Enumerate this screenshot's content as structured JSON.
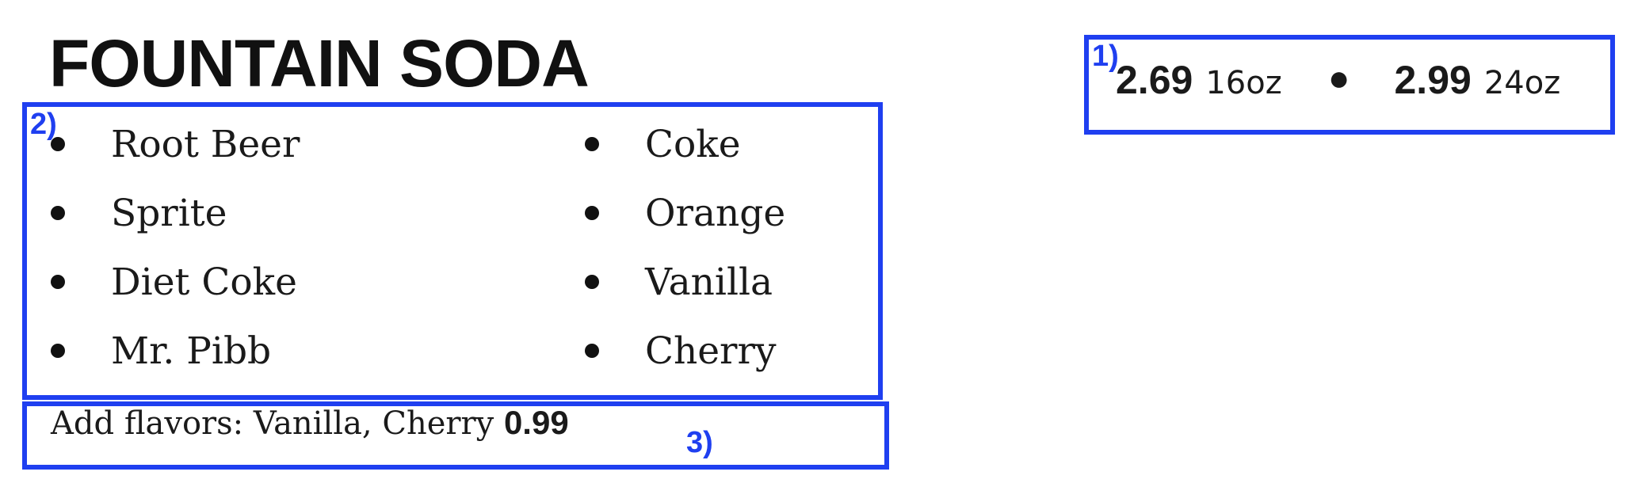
{
  "title": "FOUNTAIN SODA",
  "prices": [
    {
      "value": "2.69",
      "size": "16oz"
    },
    {
      "value": "2.99",
      "size": "24oz"
    }
  ],
  "flavors": {
    "left": [
      "Root Beer",
      "Sprite",
      "Diet Coke",
      "Mr. Pibb"
    ],
    "right": [
      "Coke",
      "Orange",
      "Vanilla",
      "Cherry"
    ]
  },
  "add_flavors": {
    "text": "Add flavors: Vanilla, Cherry",
    "price": "0.99"
  },
  "annotations": {
    "box1": "1)",
    "box2": "2)",
    "box3": "3)"
  },
  "colors": {
    "annotation": "#1f3ff0"
  }
}
